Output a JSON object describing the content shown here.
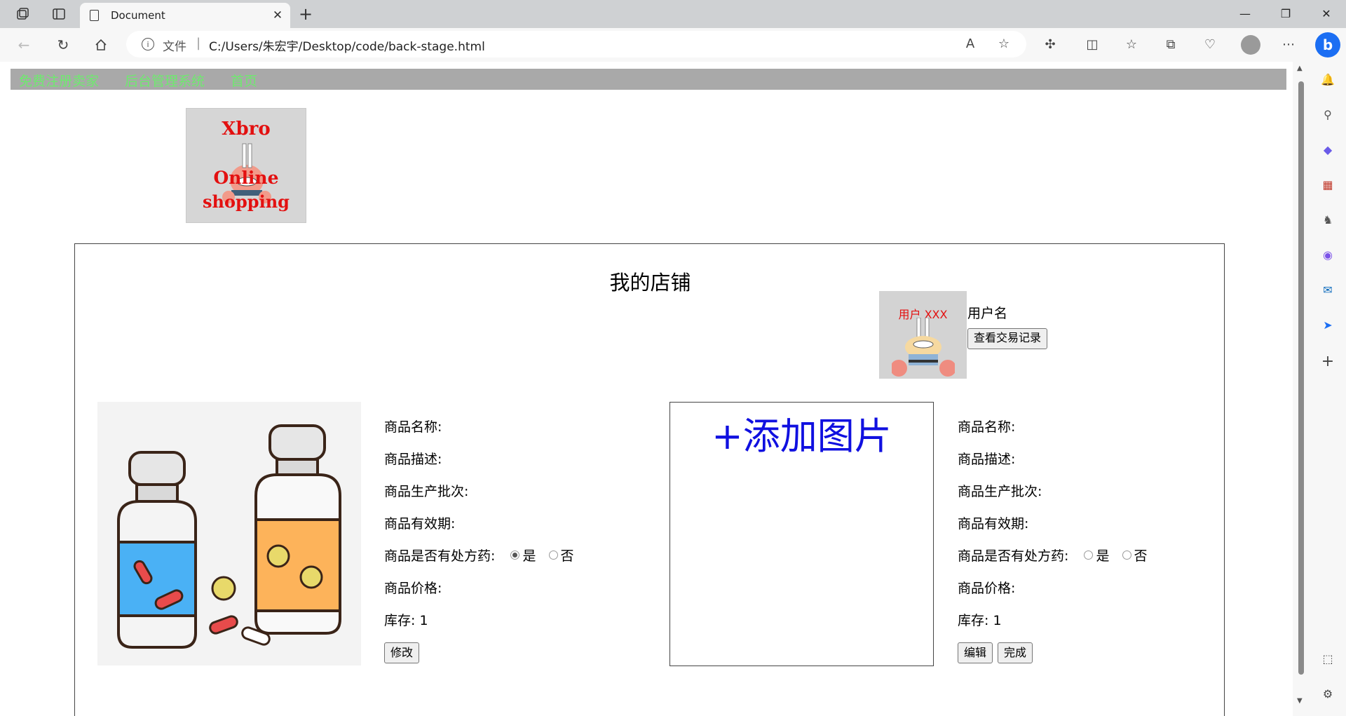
{
  "browser": {
    "tab_title": "Document",
    "tab_close": "✕",
    "new_tab": "+",
    "address_prefix": "文件",
    "address_separator": "|",
    "url": "C:/Users/朱宏宇/Desktop/code/back-stage.html",
    "window": {
      "minimize": "—",
      "restore": "❐",
      "close": "✕"
    }
  },
  "page": {
    "nav": [
      "免费注册卖家",
      "后台管理系统",
      "首页"
    ],
    "logo": {
      "line1": "Xbro",
      "line2": "Online",
      "line3": "shopping"
    },
    "shop": {
      "title": "我的店铺",
      "avatar_label": "用户 XXX",
      "username": "用户名",
      "history_button": "查看交易记录"
    },
    "product_left": {
      "name_label": "商品名称:",
      "desc_label": "商品描述:",
      "batch_label": "商品生产批次:",
      "expiry_label": "商品有效期:",
      "rx_label": "商品是否有处方药:",
      "rx_yes": "是",
      "rx_no": "否",
      "rx_selected": "是",
      "price_label": "商品价格:",
      "stock_label": "库存:",
      "stock_value": "1",
      "edit_button": "修改"
    },
    "add_image": {
      "text": "+添加图片"
    },
    "product_right": {
      "name_label": "商品名称:",
      "desc_label": "商品描述:",
      "batch_label": "商品生产批次:",
      "expiry_label": "商品有效期:",
      "rx_label": "商品是否有处方药:",
      "rx_yes": "是",
      "rx_no": "否",
      "rx_selected": "",
      "price_label": "商品价格:",
      "stock_label": "库存:",
      "stock_value": "1",
      "edit_button": "编辑",
      "done_button": "完成"
    }
  },
  "colors": {
    "nav_bg": "#a9a9a9",
    "nav_link": "#6eea6e",
    "logo_red": "#e31010",
    "add_image_blue": "#1010e0"
  }
}
